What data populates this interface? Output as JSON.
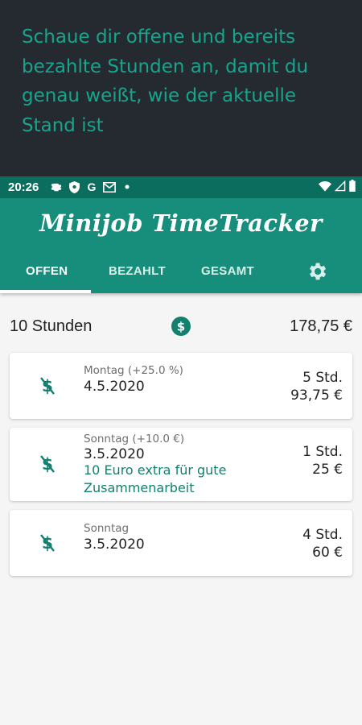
{
  "promo": {
    "text": "Schaue dir offene und bereits bezahlte Stunden an, damit du genau weißt, wie der aktuelle Stand ist"
  },
  "status_bar": {
    "time": "20:26",
    "icons": [
      "gear-icon",
      "shield-icon",
      "google-icon",
      "gmail-icon",
      "dot-icon",
      "wifi-icon",
      "signal-icon",
      "battery-icon"
    ],
    "google_glyph": "G"
  },
  "app": {
    "title": "Minijob TimeTracker",
    "tabs": [
      {
        "label": "OFFEN",
        "active": true
      },
      {
        "label": "BEZAHLT",
        "active": false
      },
      {
        "label": "GESAMT",
        "active": false
      }
    ],
    "settings_icon": "gear-icon"
  },
  "summary": {
    "hours": "10 Stunden",
    "amount": "178,75 €",
    "icon": "dollar-circle-icon"
  },
  "entries": [
    {
      "label": "Montag (+25.0 %)",
      "date": "4.5.2020",
      "note": "",
      "hours": "5 Std.",
      "amount": "93,75 €",
      "icon": "dollar-off-icon"
    },
    {
      "label": "Sonntag (+10.0 €)",
      "date": "3.5.2020",
      "note": "10 Euro extra für gute Zusammenarbeit",
      "hours": "1 Std.",
      "amount": "25 €",
      "icon": "dollar-off-icon"
    },
    {
      "label": "Sonntag",
      "date": "3.5.2020",
      "note": "",
      "hours": "4 Std.",
      "amount": "60 €",
      "icon": "dollar-off-icon"
    }
  ],
  "colors": {
    "primary": "#168e7b",
    "primary_dark": "#0b6d5e",
    "promo_bg": "#252a31",
    "promo_text": "#16a58c",
    "accent": "#13806f"
  }
}
